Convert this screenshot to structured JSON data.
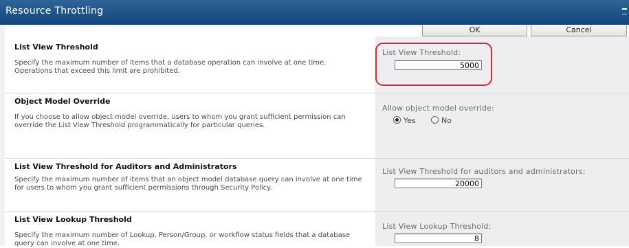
{
  "window": {
    "title": "Resource Throttling"
  },
  "buttons": {
    "ok_label": "OK",
    "cancel_label": "Cancel"
  },
  "sections": [
    {
      "heading": "List View Threshold",
      "description": "Specify the maximum number of items that a database operation can involve at one time. Operations that exceed this limit are prohibited.",
      "field_label": "List View Threshold:",
      "value": "5000"
    },
    {
      "heading": "Object Model Override",
      "description": "If you choose to allow object model override, users to whom you grant sufficient permission can override the List View Threshold programmatically for particular queries.",
      "field_label": "Allow object model override:",
      "options": [
        "Yes",
        "No"
      ],
      "selected": "Yes"
    },
    {
      "heading": "List View Threshold for Auditors and Administrators",
      "description": "Specify the maximum number of items that an object model database query can involve at one time for users to whom you grant sufficient permissions through Security Policy.",
      "field_label": "List View Threshold for auditors and administrators:",
      "value": "20000"
    },
    {
      "heading": "List View Lookup Threshold",
      "description": "Specify the maximum number of Lookup, Person/Group, or workflow status fields that a database query can involve at one time.",
      "field_label": "List View Lookup Threshold:",
      "value": "8"
    }
  ],
  "colors": {
    "titlebar": "#1f5389",
    "highlight": "#e0262b",
    "control_panel": "#f0edf0"
  }
}
